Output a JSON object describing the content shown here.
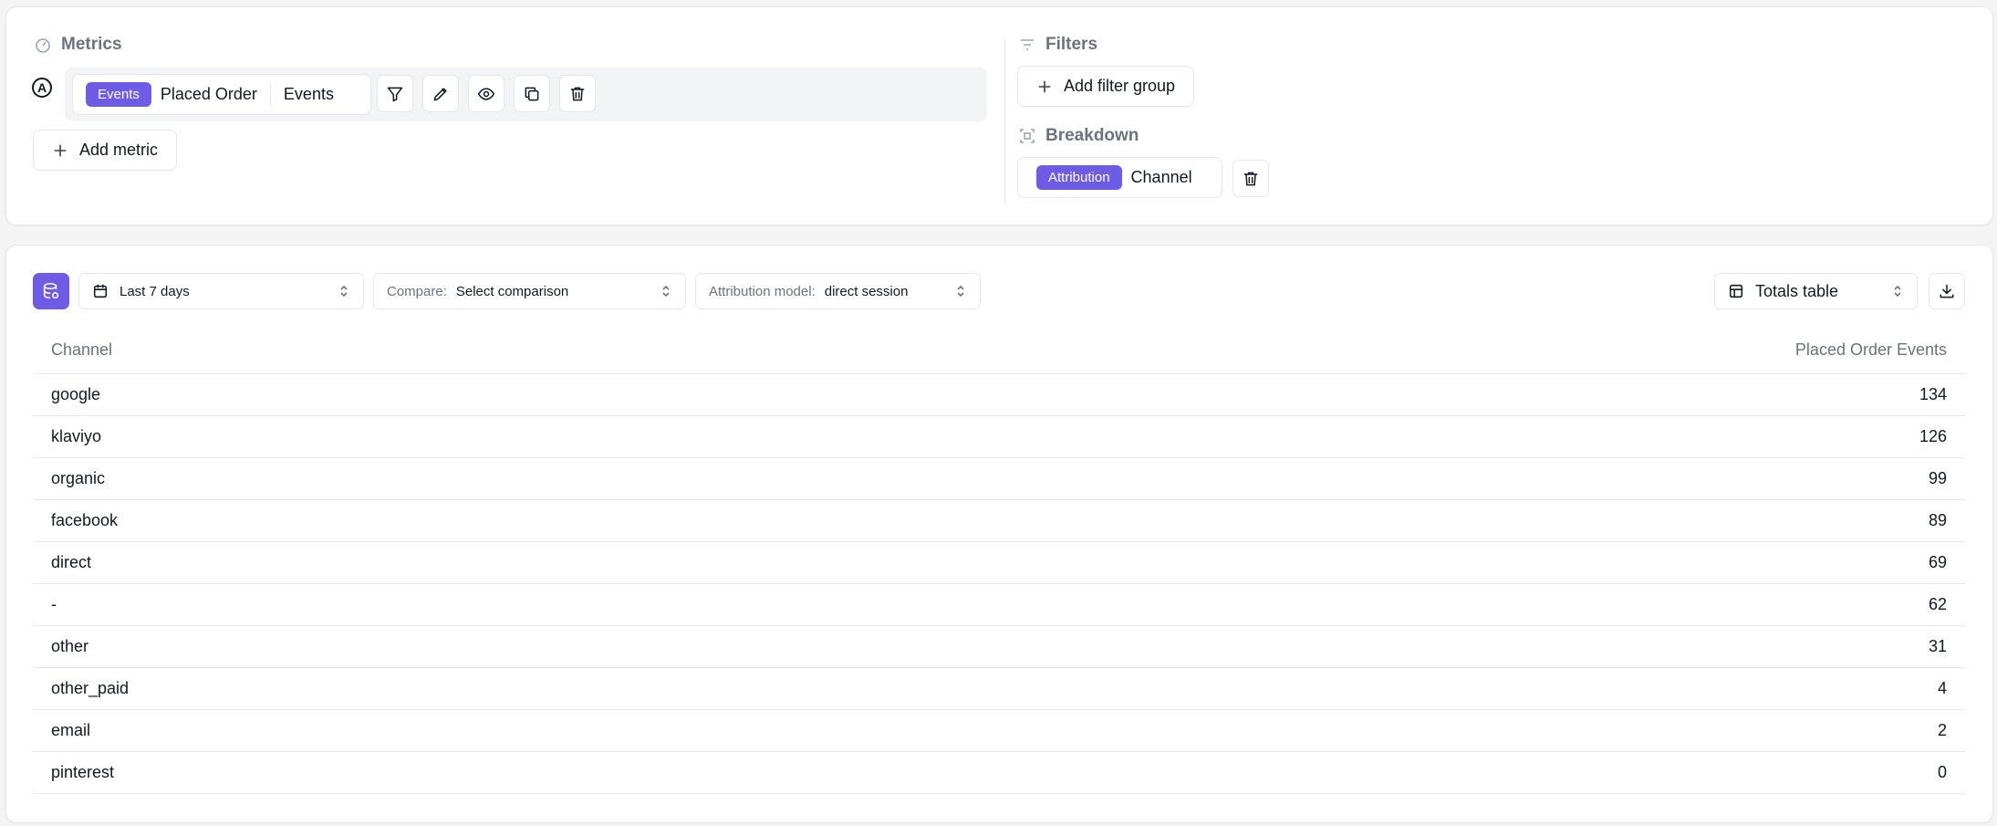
{
  "metrics": {
    "title": "Metrics",
    "metric_letter": "A",
    "metric": {
      "badge": "Events",
      "name": "Placed Order",
      "type": "Events"
    },
    "add_metric_label": "Add metric"
  },
  "filters": {
    "title": "Filters",
    "add_filter_group_label": "Add filter group"
  },
  "breakdown": {
    "title": "Breakdown",
    "badge": "Attribution",
    "value": "Channel"
  },
  "toolbar": {
    "date_range": "Last 7 days",
    "compare_label": "Compare:",
    "compare_value": "Select comparison",
    "attribution_label": "Attribution model:",
    "attribution_value": "direct session",
    "view_label": "Totals table"
  },
  "table": {
    "columns": [
      "Channel",
      "Placed Order Events"
    ],
    "rows": [
      {
        "channel": "google",
        "value": "134"
      },
      {
        "channel": "klaviyo",
        "value": "126"
      },
      {
        "channel": "organic",
        "value": "99"
      },
      {
        "channel": "facebook",
        "value": "89"
      },
      {
        "channel": "direct",
        "value": "69"
      },
      {
        "channel": "-",
        "value": "62"
      },
      {
        "channel": "other",
        "value": "31"
      },
      {
        "channel": "other_paid",
        "value": "4"
      },
      {
        "channel": "email",
        "value": "2"
      },
      {
        "channel": "pinterest",
        "value": "0"
      }
    ]
  },
  "colors": {
    "accent": "#6f5ce6",
    "border": "#e5e7eb",
    "muted_text": "#6b7280"
  }
}
